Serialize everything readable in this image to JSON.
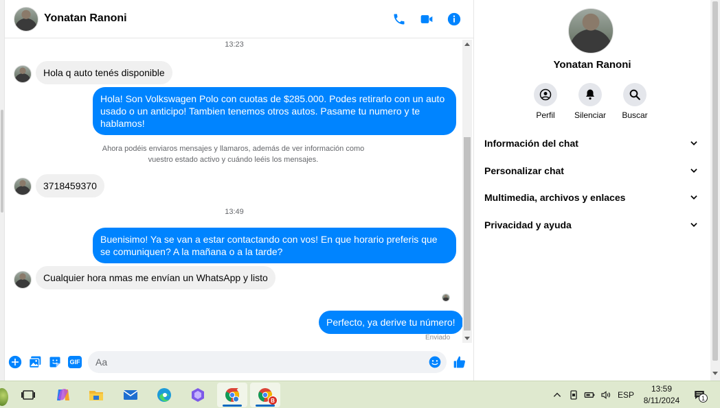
{
  "contact": {
    "name": "Yonatan Ranoni"
  },
  "header": {
    "icons": [
      "phone-icon",
      "video-icon",
      "info-icon"
    ],
    "accent_color": "#0084ff"
  },
  "messages": {
    "timestamp_1": "13:23",
    "m1": "Hola q auto tenés disponible",
    "m2": "Hola! Son Volkswagen Polo con cuotas de $285.000. Podes retirarlo con un auto usado o un anticipo! Tambien tenemos otros autos. Pasame tu numero y te hablamos!",
    "notice": "Ahora podéis enviaros mensajes y llamaros, además de ver información como vuestro estado activo y cuándo leéis los mensajes.",
    "m3": "3718459370",
    "timestamp_2": "13:49",
    "m4": "Buenisimo! Ya se van a estar contactando con vos! En que horario preferis que se comuniquen? A la mañana o a la tarde?",
    "m5": "Cualquier hora nmas me envían un WhatsApp y listo",
    "m6": "Perfecto, ya derive tu número!",
    "status": "Enviado"
  },
  "composer": {
    "placeholder": "Aa",
    "gif_label": "GIF"
  },
  "info_panel": {
    "actions": [
      {
        "label": "Perfil",
        "icon": "profile-icon"
      },
      {
        "label": "Silenciar",
        "icon": "bell-icon"
      },
      {
        "label": "Buscar",
        "icon": "search-icon"
      }
    ],
    "sections": [
      "Información del chat",
      "Personalizar chat",
      "Multimedia, archivos y enlaces",
      "Privacidad y ayuda"
    ]
  },
  "taskbar": {
    "language": "ESP",
    "time": "13:59",
    "date": "8/11/2024",
    "notification_count": "1",
    "chrome_badge": "B",
    "taskbar_color": "#dfe9cf"
  }
}
